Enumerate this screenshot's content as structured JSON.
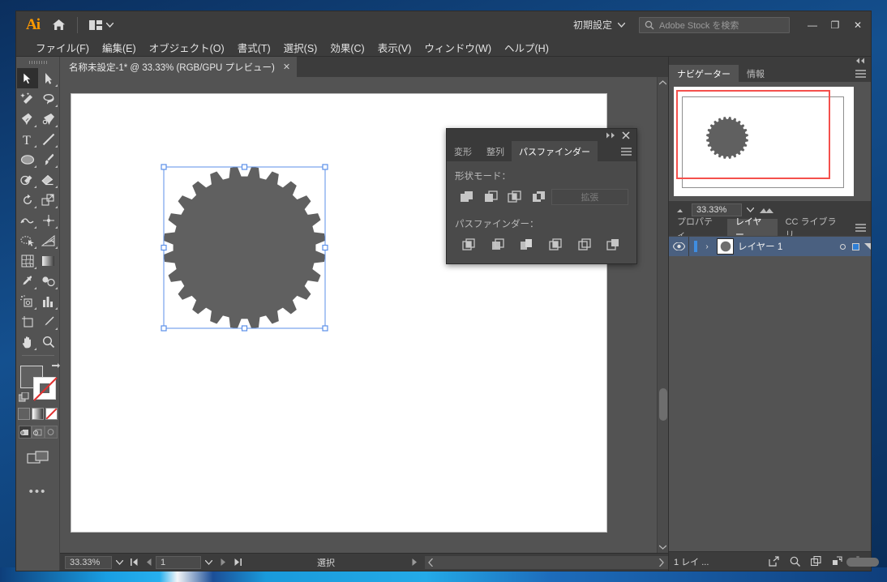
{
  "titlebar": {
    "app_logo": "Ai",
    "home_icon": "home-icon",
    "grid_icon": "arrange-documents-icon",
    "workspace": "初期設定",
    "search_placeholder": "Adobe Stock を検索",
    "minimize": "—",
    "maximize": "❐",
    "close": "✕"
  },
  "menubar": {
    "items": [
      {
        "label": "ファイル(F)"
      },
      {
        "label": "編集(E)"
      },
      {
        "label": "オブジェクト(O)"
      },
      {
        "label": "書式(T)"
      },
      {
        "label": "選択(S)"
      },
      {
        "label": "効果(C)"
      },
      {
        "label": "表示(V)"
      },
      {
        "label": "ウィンドウ(W)"
      },
      {
        "label": "ヘルプ(H)"
      }
    ]
  },
  "document": {
    "tab_title": "名称未設定-1* @ 33.33% (RGB/GPU プレビュー)",
    "close_glyph": "✕"
  },
  "toolbar": {
    "tools": [
      {
        "name": "selection-tool",
        "active": true
      },
      {
        "name": "direct-selection-tool",
        "active": false
      },
      {
        "name": "magic-wand-tool",
        "active": false
      },
      {
        "name": "lasso-tool",
        "active": false
      },
      {
        "name": "pen-tool",
        "active": false
      },
      {
        "name": "curvature-tool",
        "active": false
      },
      {
        "name": "type-tool",
        "active": false
      },
      {
        "name": "line-segment-tool",
        "active": false
      },
      {
        "name": "ellipse-tool",
        "active": false
      },
      {
        "name": "paintbrush-tool",
        "active": false
      },
      {
        "name": "shaper-tool",
        "active": false
      },
      {
        "name": "eraser-tool",
        "active": false
      },
      {
        "name": "rotate-tool",
        "active": false
      },
      {
        "name": "scale-tool",
        "active": false
      },
      {
        "name": "width-tool",
        "active": false
      },
      {
        "name": "free-transform-tool",
        "active": false
      },
      {
        "name": "shape-builder-tool",
        "active": false
      },
      {
        "name": "perspective-grid-tool",
        "active": false
      },
      {
        "name": "mesh-tool",
        "active": false
      },
      {
        "name": "gradient-tool",
        "active": false
      },
      {
        "name": "eyedropper-tool",
        "active": false
      },
      {
        "name": "blend-tool",
        "active": false
      },
      {
        "name": "symbol-sprayer-tool",
        "active": false
      },
      {
        "name": "column-graph-tool",
        "active": false
      },
      {
        "name": "artboard-tool",
        "active": false
      },
      {
        "name": "slice-tool",
        "active": false
      },
      {
        "name": "hand-tool",
        "active": false
      },
      {
        "name": "zoom-tool",
        "active": false
      }
    ],
    "fill_color": "#606060",
    "stroke_color": "none",
    "more_tools": "•••"
  },
  "pathfinder_panel": {
    "collapse_icon": "collapse-icon",
    "close_icon": "close-icon",
    "menu_icon": "panel-menu-icon",
    "tabs": [
      {
        "label": "変形",
        "active": false
      },
      {
        "label": "整列",
        "active": false
      },
      {
        "label": "パスファインダー",
        "active": true
      }
    ],
    "shape_mode_label": "形状モード：",
    "shape_mode_buttons": [
      {
        "name": "unite-button"
      },
      {
        "name": "minus-front-button"
      },
      {
        "name": "intersect-button"
      },
      {
        "name": "exclude-button"
      }
    ],
    "expand_label": "拡張",
    "pathfinder_label": "パスファインダー：",
    "pathfinder_buttons": [
      {
        "name": "divide-button"
      },
      {
        "name": "trim-button"
      },
      {
        "name": "merge-button"
      },
      {
        "name": "crop-button"
      },
      {
        "name": "outline-button"
      },
      {
        "name": "minus-back-button"
      }
    ]
  },
  "navigator": {
    "tabs": [
      {
        "label": "ナビゲーター",
        "active": true
      },
      {
        "label": "情報",
        "active": false
      }
    ],
    "menu_icon": "panel-menu-icon",
    "zoom_value": "33.33%",
    "zoom_out_icon": "zoom-out-icon",
    "zoom_in_icon": "zoom-in-icon",
    "view_box_color": "#f4504c"
  },
  "layers": {
    "tabs": [
      {
        "label": "プロパティ",
        "active": false
      },
      {
        "label": "レイヤー",
        "active": true
      },
      {
        "label": "CC ライブラリ",
        "active": false
      }
    ],
    "menu_icon": "panel-menu-icon",
    "rows": [
      {
        "eye_icon": "eye-icon",
        "expand_glyph": "›",
        "name": "レイヤー 1",
        "target_icon": "target-circle-icon",
        "selection_color": "#2f7fd6"
      }
    ],
    "footer_count": "1 レイ ...",
    "footer_icons": [
      {
        "name": "locate-object-icon"
      },
      {
        "name": "make-clipping-mask-icon"
      },
      {
        "name": "create-new-sublayer-icon"
      },
      {
        "name": "create-new-layer-icon"
      },
      {
        "name": "delete-selection-icon"
      }
    ]
  },
  "statusbar": {
    "zoom_value": "33.33%",
    "zoom_dropdown_icon": "chevron-down-icon",
    "first_artboard_icon": "first-artboard-icon",
    "prev_artboard_icon": "prev-artboard-icon",
    "artboard_number": "1",
    "artboard_dropdown_icon": "chevron-down-icon",
    "next_artboard_icon": "next-artboard-icon",
    "last_artboard_icon": "last-artboard-icon",
    "status_text": "選択",
    "scroll_left_icon": "scroll-left-icon",
    "scroll_right_icon": "scroll-right-icon"
  },
  "canvas": {
    "artboard_background": "#ffffff",
    "selected_object": {
      "name": "gear-shape",
      "fill": "#606060",
      "teeth": 24,
      "selection_color": "#5b8fe8"
    }
  }
}
